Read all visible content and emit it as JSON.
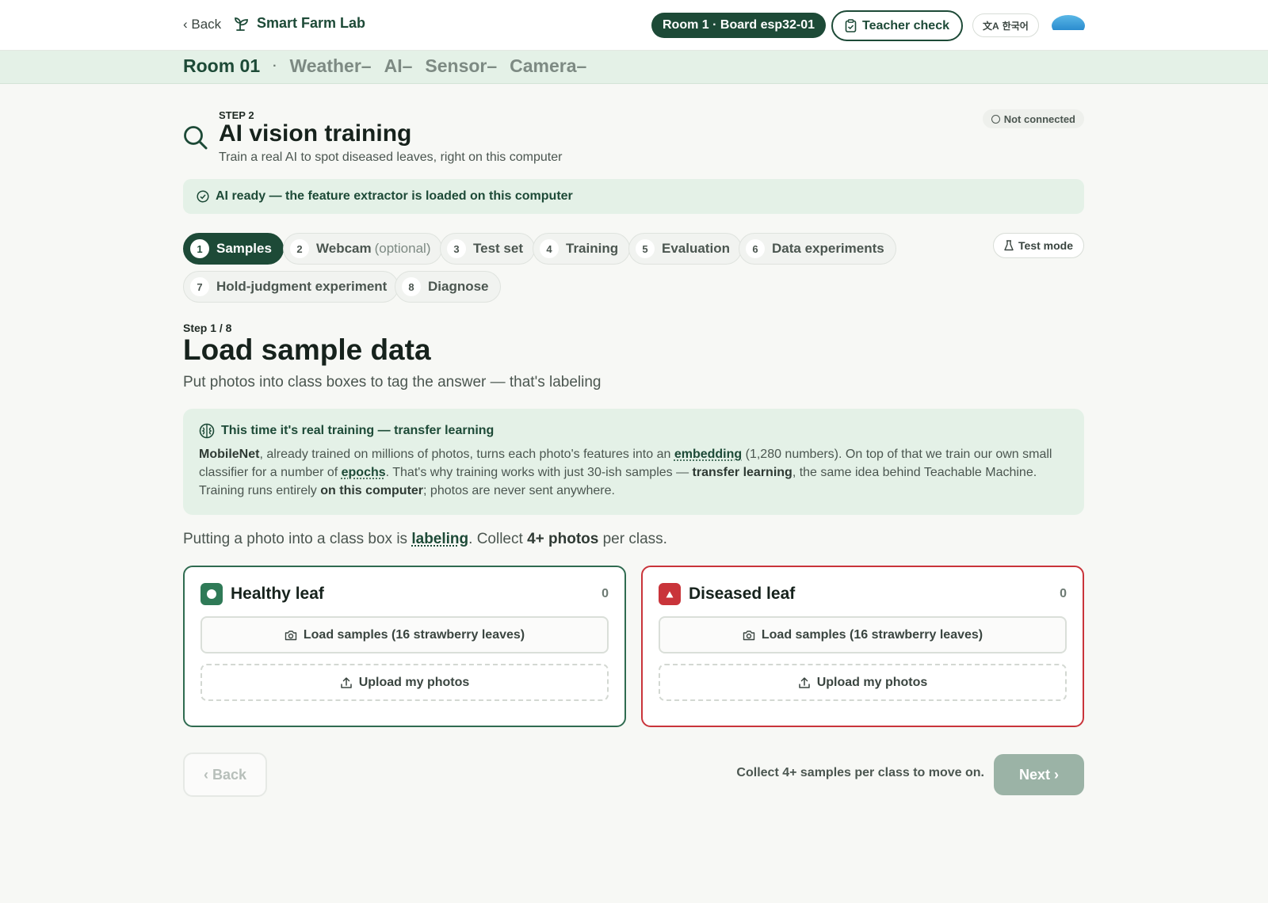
{
  "topbar": {
    "back_label": "‹ Back",
    "brand_name": "Smart Farm Lab",
    "room_board": "Room 1 · Board esp32-01",
    "teacher_check": "Teacher check",
    "language": "한국어"
  },
  "strip": {
    "room": "Room 01",
    "separator": "·",
    "items": [
      "Weather–",
      "AI–",
      "Sensor–",
      "Camera–"
    ]
  },
  "header": {
    "kicker": "STEP 2",
    "title": "AI vision training",
    "subtitle": "Train a real AI to spot diseased leaves, right on this computer",
    "connection": "Not connected"
  },
  "ready_banner": "AI ready — the feature extractor is loaded on this computer",
  "tabs": [
    {
      "num": "1",
      "label": "Samples",
      "active": true
    },
    {
      "num": "2",
      "label": "Webcam",
      "extra": "(optional)"
    },
    {
      "num": "3",
      "label": "Test set"
    },
    {
      "num": "4",
      "label": "Training"
    },
    {
      "num": "5",
      "label": "Evaluation"
    },
    {
      "num": "6",
      "label": "Data experiments"
    },
    {
      "num": "7",
      "label": "Hold-judgment experiment"
    },
    {
      "num": "8",
      "label": "Diagnose"
    }
  ],
  "test_mode": "Test mode",
  "step": {
    "count": "Step 1 / 8",
    "title": "Load sample data",
    "subtitle": "Put photos into class boxes to tag the answer — that's labeling"
  },
  "info": {
    "heading": "This time it's real training — transfer learning",
    "p1_b1": "MobileNet",
    "p1_t1": ", already trained on millions of photos, turns each photo's features into an ",
    "p1_u1": "embedding",
    "p1_t2": " (1,280 numbers). On top of that we train our own small classifier for a number of ",
    "p1_u2": "epochs",
    "p1_t3": ". That's why training works with just 30-ish samples — ",
    "p1_b2": "transfer learning",
    "p1_t4": ", the same idea behind Teachable Machine. Training runs entirely ",
    "p1_b3": "on this computer",
    "p1_t5": "; photos are never sent anywhere."
  },
  "labeling_line": {
    "t1": "Putting a photo into a class box is ",
    "u1": "labeling",
    "t2": ". Collect ",
    "b1": "4+ photos",
    "t3": " per class."
  },
  "classes": [
    {
      "name": "Healthy leaf",
      "count": "0",
      "load_label": "Load samples (16 strawberry leaves)",
      "upload_label": "Upload my photos",
      "color": "#2f7a57"
    },
    {
      "name": "Diseased leaf",
      "count": "0",
      "load_label": "Load samples (16 strawberry leaves)",
      "upload_label": "Upload my photos",
      "color": "#c9343a"
    }
  ],
  "footer": {
    "back_label": "‹ Back",
    "hint": "Collect 4+ samples per class to move on.",
    "next_label": "Next ›"
  },
  "colors": {
    "brand": "#1d4a37",
    "accent_bg": "#e4f1e7",
    "healthy": "#2f7a57",
    "diseased": "#c9343a"
  },
  "icons": [
    "sprout-icon",
    "clipboard-icon",
    "translate-icon",
    "search-icon",
    "check-circle-icon",
    "flask-icon",
    "brain-icon",
    "camera-icon",
    "upload-icon"
  ]
}
